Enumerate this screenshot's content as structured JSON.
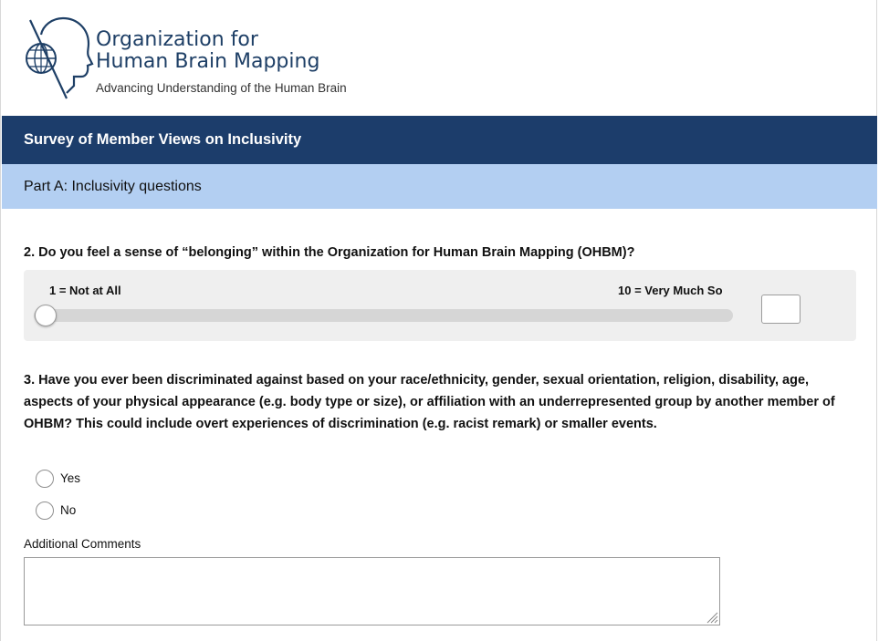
{
  "header": {
    "org_line1": "Organization for",
    "org_line2": "Human Brain Mapping",
    "tagline": "Advancing Understanding of the Human Brain",
    "logo_icon": "brain-head-globe-logo"
  },
  "survey": {
    "title": "Survey of Member Views on Inclusivity",
    "part": "Part A: Inclusivity questions"
  },
  "q2": {
    "text": "2. Do you feel a sense of “belonging” within the Organization for Human Brain Mapping (OHBM)?",
    "min_label": "1 = Not at All",
    "max_label": "10 = Very Much So",
    "slider_min": 1,
    "slider_max": 10,
    "value": ""
  },
  "q3": {
    "text": "3. Have you ever been discriminated against based on your race/ethnicity, gender, sexual orientation, religion, disability, age, aspects of your physical appearance (e.g. body type or size), or affiliation with an underrepresented group by another member of OHBM? This could include overt experiences of discrimination (e.g. racist remark) or smaller events.",
    "options": [
      "Yes",
      "No"
    ],
    "comments_label": "Additional Comments",
    "comments_value": ""
  },
  "colors": {
    "title_bar": "#1c3d6b",
    "part_bar": "#b3cff2",
    "brand_text": "#1e3f66"
  }
}
